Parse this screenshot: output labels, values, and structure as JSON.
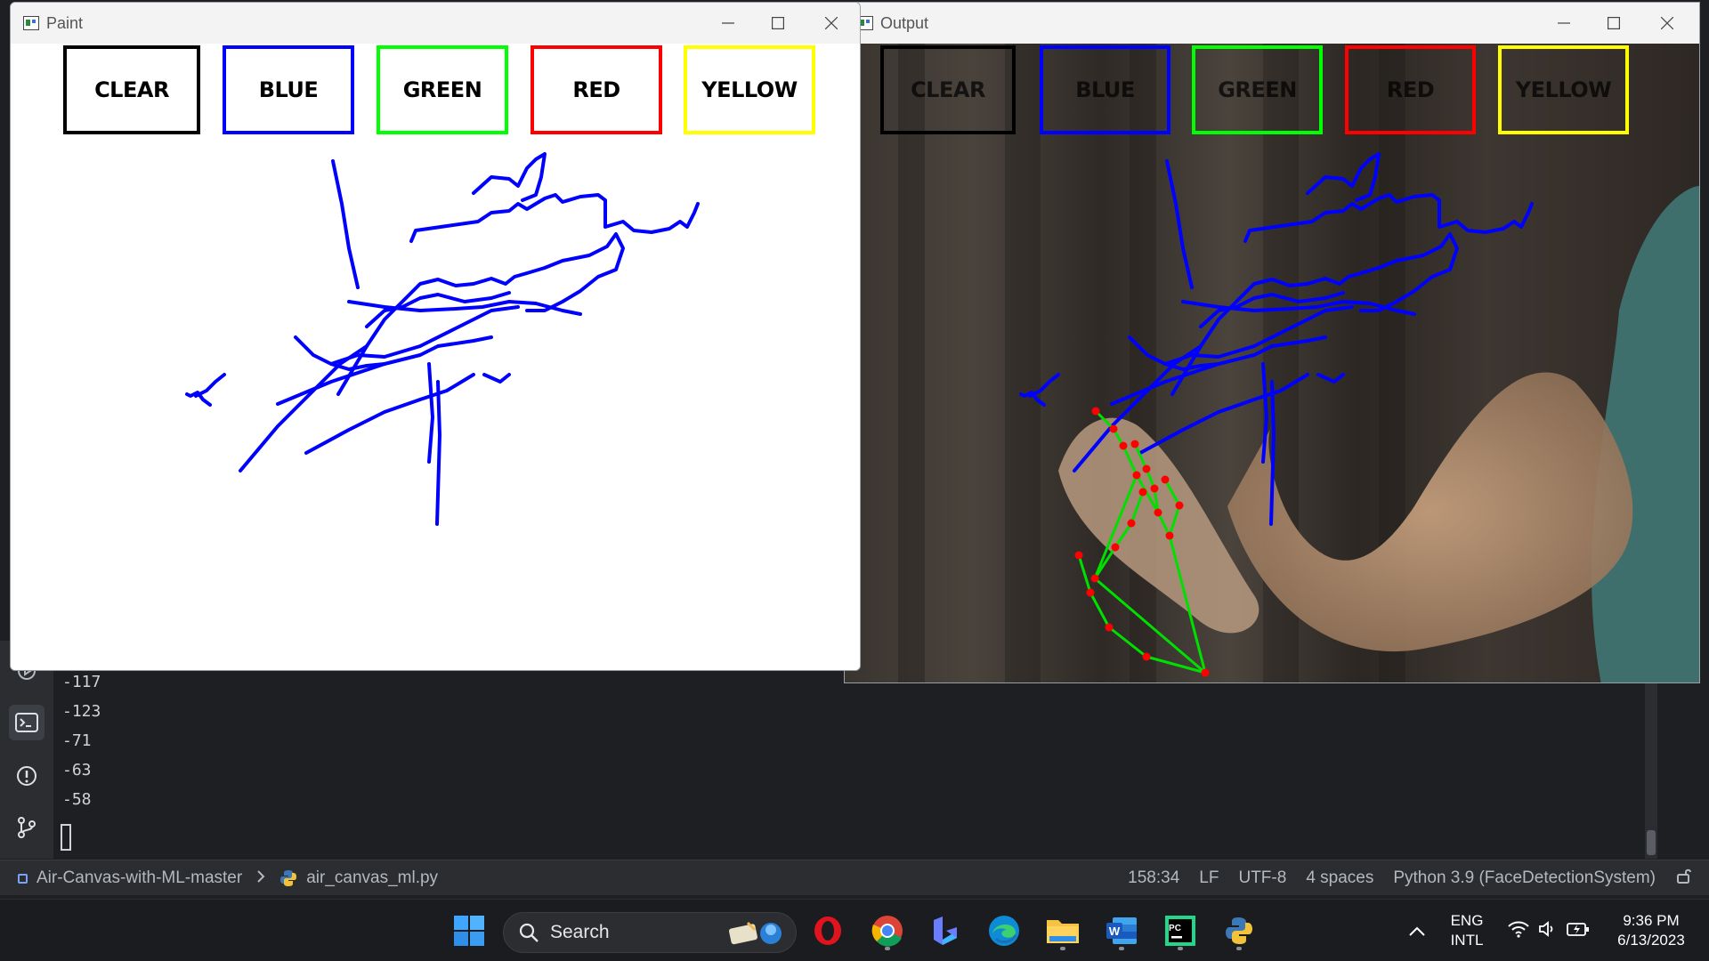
{
  "paint_window": {
    "title": "Paint",
    "buttons": [
      {
        "label": "CLEAR",
        "color": "#000000"
      },
      {
        "label": "BLUE",
        "color": "#0000ff"
      },
      {
        "label": "GREEN",
        "color": "#00ff00"
      },
      {
        "label": "RED",
        "color": "#ff0000"
      },
      {
        "label": "YELLOW",
        "color": "#ffff00"
      }
    ]
  },
  "output_window": {
    "title": "Output",
    "buttons": [
      {
        "label": "CLEAR",
        "color": "#000000"
      },
      {
        "label": "BLUE",
        "color": "#0000ff"
      },
      {
        "label": "GREEN",
        "color": "#00ff00"
      },
      {
        "label": "RED",
        "color": "#ff0000"
      },
      {
        "label": "YELLOW",
        "color": "#ffff00"
      }
    ]
  },
  "stroke_color": "#0000ff",
  "landmark_colors": {
    "connection": "#00e000",
    "point": "#ff0000"
  },
  "terminal": {
    "lines": [
      "-117",
      "-123",
      "-71",
      "-63",
      "-58"
    ]
  },
  "statusbar": {
    "project": "Air-Canvas-with-ML-master",
    "file": "air_canvas_ml.py",
    "position": "158:34",
    "line_ending": "LF",
    "encoding": "UTF-8",
    "indent": "4 spaces",
    "interpreter": "Python 3.9 (FaceDetectionSystem)"
  },
  "taskbar": {
    "search_label": "Search",
    "lang_top": "ENG",
    "lang_bottom": "INTL",
    "time": "9:36 PM",
    "date": "6/13/2023"
  }
}
